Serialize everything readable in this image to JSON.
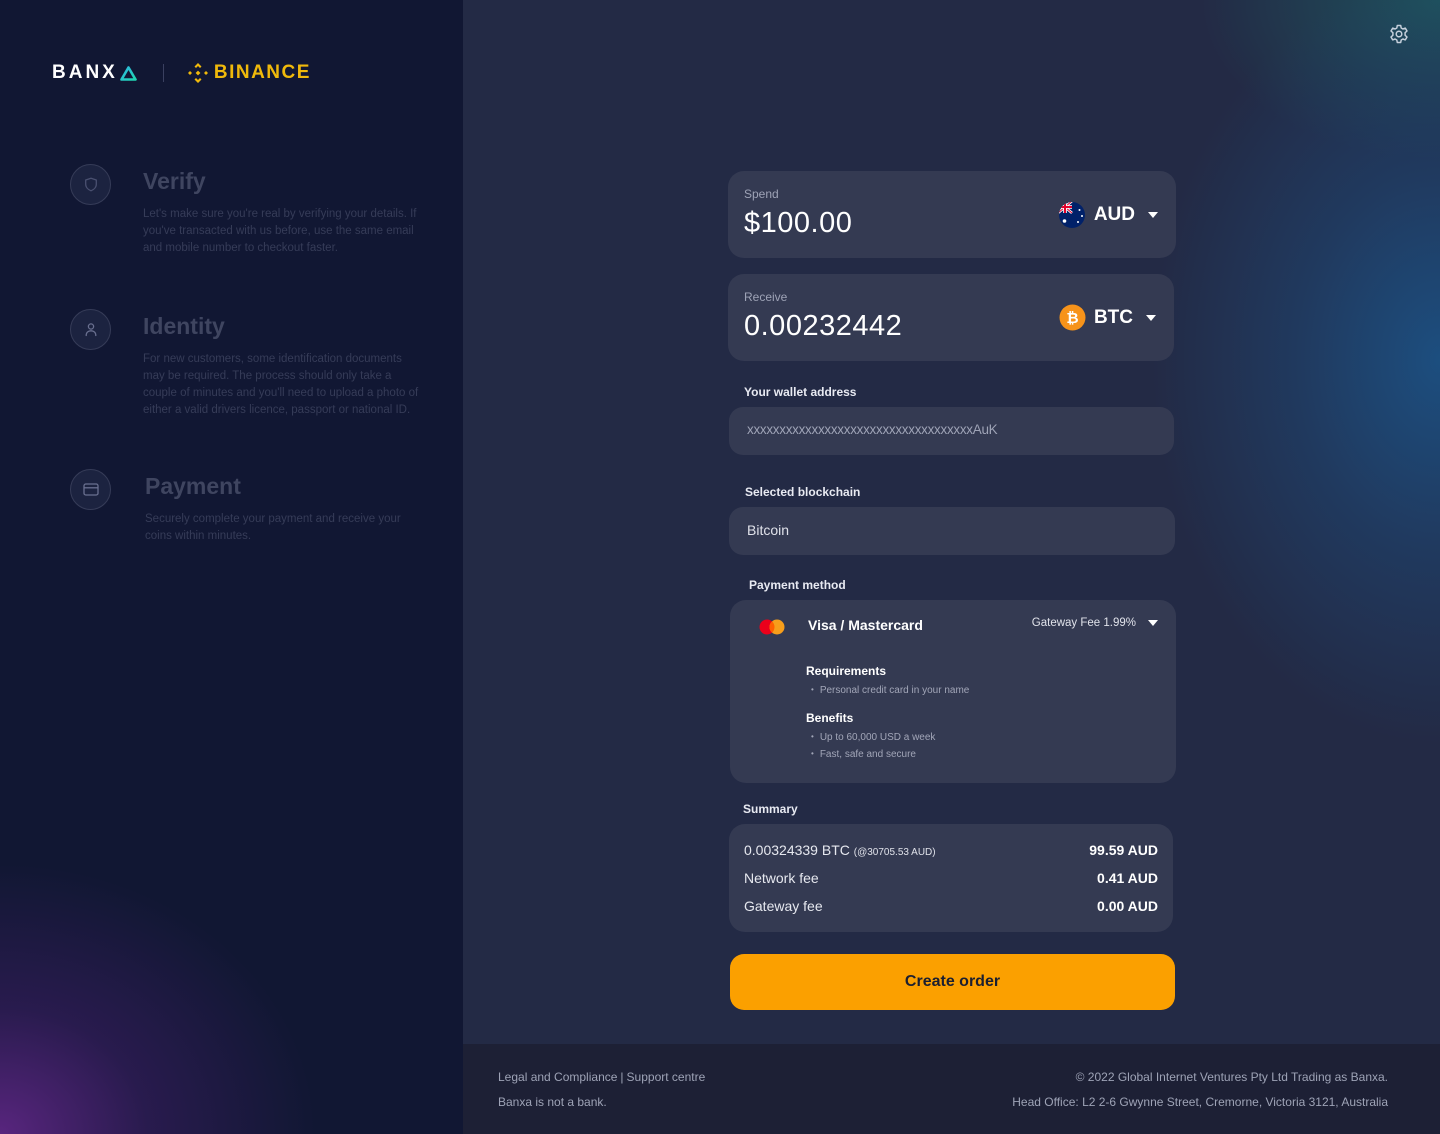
{
  "brand": {
    "banxa": "BANX",
    "partner": "BINANCE",
    "accent_banxa": "#20c3cf",
    "accent_binance": "#f0b90b"
  },
  "steps": [
    {
      "title": "Verify",
      "icon": "shield-icon",
      "description": "Let's make sure you're real by verifying your details. If you've transacted with us before, use the same email and mobile number to checkout faster."
    },
    {
      "title": "Identity",
      "icon": "user-icon",
      "description": "For new customers, some identification documents may be required. The process should only take a couple of minutes and you'll need to upload a photo of either a valid drivers licence, passport or national ID."
    },
    {
      "title": "Payment",
      "icon": "credit-card-icon",
      "description": "Securely complete your payment and receive your coins within minutes."
    }
  ],
  "settings": {
    "icon": "gear-icon"
  },
  "spend": {
    "label": "Spend",
    "value": "$100.00",
    "currency": "AUD",
    "icon": "australia-flag-icon"
  },
  "receive": {
    "label": "Receive",
    "value": "0.00232442",
    "currency": "BTC",
    "icon": "bitcoin-icon"
  },
  "wallet": {
    "label": "Your wallet address",
    "value": "xxxxxxxxxxxxxxxxxxxxxxxxxxxxxxxxxxxAuK"
  },
  "blockchain": {
    "label": "Selected blockchain",
    "value": "Bitcoin"
  },
  "payment_method": {
    "label": "Payment method",
    "name": "Visa / Mastercard",
    "icon": "mastercard-icon",
    "fee": "Gateway Fee 1.99%",
    "requirements_title": "Requirements",
    "requirements": [
      "Personal credit card in your name"
    ],
    "benefits_title": "Benefits",
    "benefits": [
      "Up to 60,000 USD a week",
      "Fast, safe and secure"
    ]
  },
  "summary": {
    "label": "Summary",
    "rows": [
      {
        "key": "0.00324339 BTC",
        "note": "(@30705.53 AUD)",
        "value": "99.59 AUD"
      },
      {
        "key": "Network fee",
        "note": "",
        "value": "0.41 AUD"
      },
      {
        "key": "Gateway fee",
        "note": "",
        "value": "0.00 AUD"
      }
    ]
  },
  "create_order": {
    "label": "Create order",
    "color": "#fba000"
  },
  "footer": {
    "legal": "Legal and Compliance",
    "separator": "|",
    "support": "Support centre",
    "note": "Banxa is not a bank.",
    "copyright": "© 2022 Global Internet Ventures Pty Ltd Trading as Banxa.",
    "address": "Head Office: L2 2-6 Gwynne Street, Cremorne, Victoria 3121, Australia"
  }
}
